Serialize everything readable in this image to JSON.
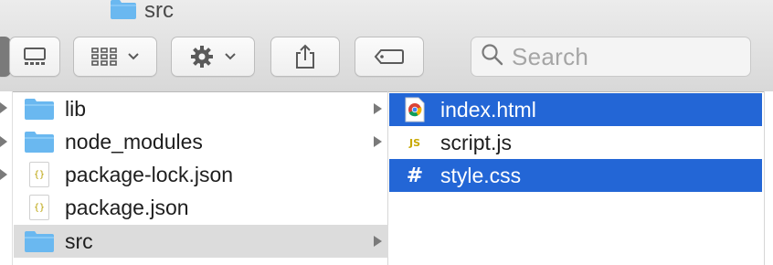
{
  "window": {
    "title": "src"
  },
  "toolbar": {
    "buttons": [
      {
        "name": "view-mode-button",
        "icon": "column-view-icon"
      },
      {
        "name": "group-button",
        "icon": "grid-view-icon"
      },
      {
        "name": "action-button",
        "icon": "gear-icon"
      },
      {
        "name": "share-button",
        "icon": "share-icon"
      },
      {
        "name": "tags-button",
        "icon": "tag-icon"
      }
    ],
    "search": {
      "placeholder": "Search"
    }
  },
  "column1": {
    "items": [
      {
        "label": "lib",
        "type": "folder",
        "has_children": true
      },
      {
        "label": "node_modules",
        "type": "folder",
        "has_children": true
      },
      {
        "label": "package-lock.json",
        "type": "json"
      },
      {
        "label": "package.json",
        "type": "json"
      },
      {
        "label": "src",
        "type": "folder",
        "has_children": true,
        "selected": true
      }
    ]
  },
  "column2": {
    "items": [
      {
        "label": "index.html",
        "type": "html",
        "selected": true
      },
      {
        "label": "script.js",
        "type": "js",
        "icon_text": "JS"
      },
      {
        "label": "style.css",
        "type": "css",
        "icon_text": "#",
        "selected": true
      }
    ]
  },
  "colors": {
    "selection_blue": "#2366d6",
    "selection_gray": "#dcdcdc",
    "folder_blue": "#6ab8f0"
  }
}
